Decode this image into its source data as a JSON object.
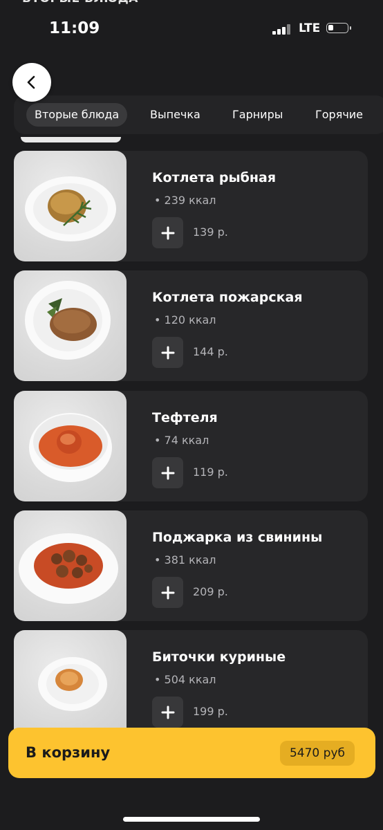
{
  "partial_heading": "ВТОРЫЕ БЛЮДА",
  "status_bar": {
    "time": "11:09",
    "network": "LTE"
  },
  "categories": [
    {
      "label": "Вторые блюда",
      "active": true
    },
    {
      "label": "Выпечка",
      "active": false
    },
    {
      "label": "Гарниры",
      "active": false
    },
    {
      "label": "Горячие",
      "active": false
    }
  ],
  "products": [
    {
      "name": "Котлета рыбная",
      "kcal": "• 239 ккал",
      "price": "139 р."
    },
    {
      "name": "Котлета пожарская",
      "kcal": "• 120 ккал",
      "price": "144 р."
    },
    {
      "name": "Тефтеля",
      "kcal": "• 74 ккал",
      "price": "119 р."
    },
    {
      "name": "Поджарка из свинины",
      "kcal": "• 381 ккал",
      "price": "209 р."
    },
    {
      "name": "Биточки куриные",
      "kcal": "• 504 ккал",
      "price": "199 р."
    }
  ],
  "cart": {
    "label": "В корзину",
    "total": "5470 руб"
  },
  "colors": {
    "accent": "#fdc32f",
    "background": "#1c1c1e",
    "card": "#272729"
  }
}
